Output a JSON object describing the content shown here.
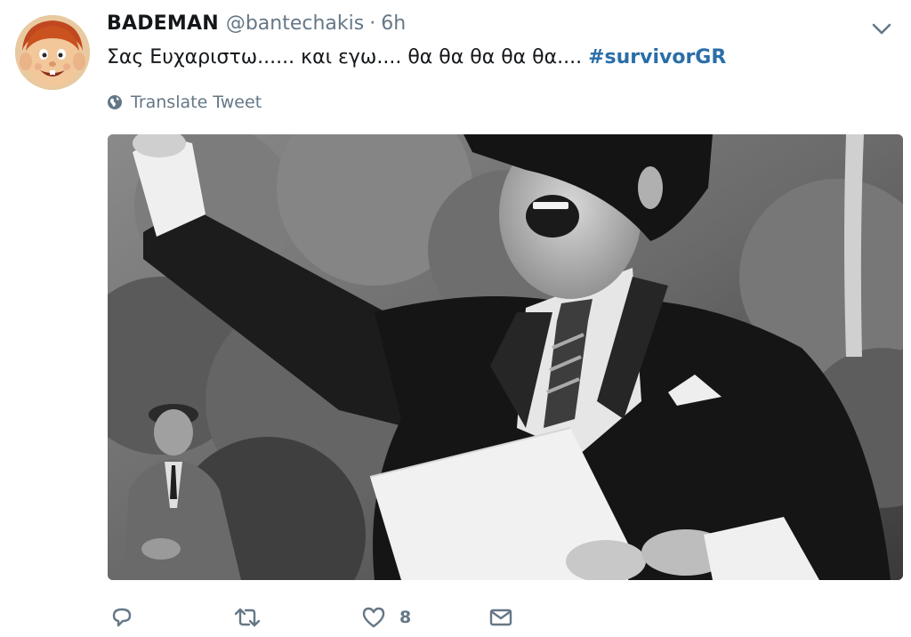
{
  "tweet": {
    "display_name": "BADEMAN",
    "handle": "@bantechakis",
    "separator": "·",
    "time": "6h",
    "text": "Σας Ευχαριστω...... και εγω.... θα θα θα θα θα.... ",
    "hashtag": "#survivorGR",
    "translate_label": "Translate Tweet",
    "media_description": "black-and-white-photo",
    "actions": {
      "reply_icon": "reply-icon",
      "retweet_icon": "retweet-icon",
      "like_icon": "heart-icon",
      "like_count": "8",
      "dm_icon": "envelope-icon"
    }
  },
  "colors": {
    "text": "#14171a",
    "secondary": "#657786",
    "hashtag": "#2a6ea8"
  }
}
